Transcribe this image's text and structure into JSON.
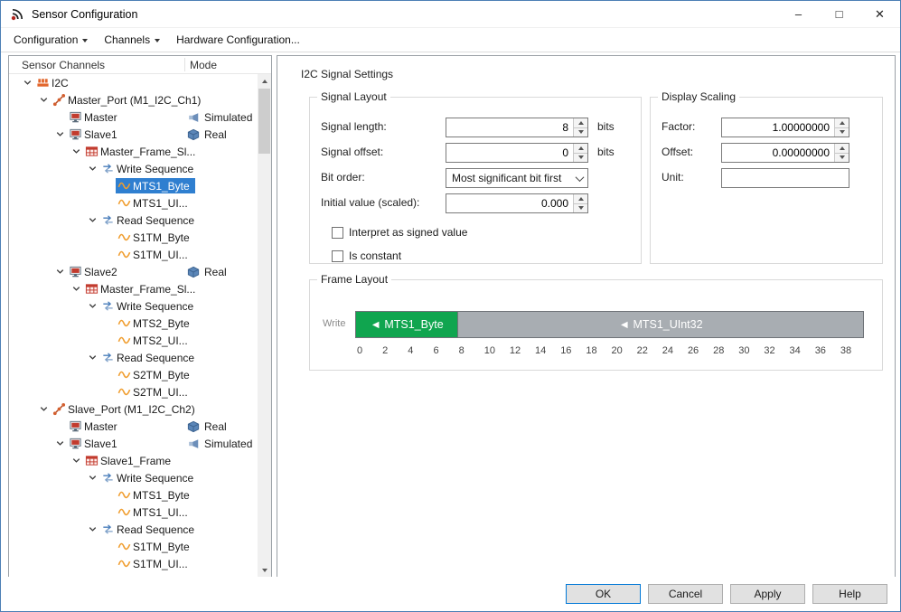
{
  "window": {
    "title": "Sensor Configuration",
    "controls": {
      "minimize": "–",
      "maximize": "□",
      "close": "✕"
    }
  },
  "colors": {
    "selection_blue": "#2f7fd0",
    "segment_green": "#10a54f",
    "segment_gray": "#a8adb2",
    "default_button_border": "#0078d7"
  },
  "menu": {
    "items": [
      {
        "label": "Configuration",
        "has_dropdown": true
      },
      {
        "label": "Channels",
        "has_dropdown": true
      },
      {
        "label": "Hardware Configuration...",
        "has_dropdown": false
      }
    ]
  },
  "tree": {
    "columns": [
      "Sensor Channels",
      "Mode"
    ],
    "items": [
      {
        "label": "I2C",
        "level": 0,
        "expanded": true,
        "icon": "i2c"
      },
      {
        "label": "Master_Port (M1_I2C_Ch1)",
        "level": 1,
        "expanded": true,
        "icon": "port"
      },
      {
        "label": "Master",
        "level": 2,
        "icon": "device",
        "mode": "Simulated"
      },
      {
        "label": "Slave1",
        "level": 2,
        "expanded": true,
        "icon": "device",
        "mode": "Real"
      },
      {
        "label": "Master_Frame_Sl...",
        "level": 3,
        "expanded": true,
        "icon": "frame"
      },
      {
        "label": "Write Sequence",
        "level": 4,
        "expanded": true,
        "icon": "sequence"
      },
      {
        "label": "MTS1_Byte",
        "level": 5,
        "icon": "signal",
        "selected": true
      },
      {
        "label": "MTS1_UI...",
        "level": 5,
        "icon": "signal"
      },
      {
        "label": "Read Sequence",
        "level": 4,
        "expanded": true,
        "icon": "sequence"
      },
      {
        "label": "S1TM_Byte",
        "level": 5,
        "icon": "signal"
      },
      {
        "label": "S1TM_UI...",
        "level": 5,
        "icon": "signal"
      },
      {
        "label": "Slave2",
        "level": 2,
        "expanded": true,
        "icon": "device",
        "mode": "Real"
      },
      {
        "label": "Master_Frame_Sl...",
        "level": 3,
        "expanded": true,
        "icon": "frame"
      },
      {
        "label": "Write Sequence",
        "level": 4,
        "expanded": true,
        "icon": "sequence"
      },
      {
        "label": "MTS2_Byte",
        "level": 5,
        "icon": "signal"
      },
      {
        "label": "MTS2_UI...",
        "level": 5,
        "icon": "signal"
      },
      {
        "label": "Read Sequence",
        "level": 4,
        "expanded": true,
        "icon": "sequence"
      },
      {
        "label": "S2TM_Byte",
        "level": 5,
        "icon": "signal"
      },
      {
        "label": "S2TM_UI...",
        "level": 5,
        "icon": "signal"
      },
      {
        "label": "Slave_Port (M1_I2C_Ch2)",
        "level": 1,
        "expanded": true,
        "icon": "port"
      },
      {
        "label": "Master",
        "level": 2,
        "icon": "device",
        "mode": "Real"
      },
      {
        "label": "Slave1",
        "level": 2,
        "expanded": true,
        "icon": "device",
        "mode": "Simulated"
      },
      {
        "label": "Slave1_Frame",
        "level": 3,
        "expanded": true,
        "icon": "frame"
      },
      {
        "label": "Write Sequence",
        "level": 4,
        "expanded": true,
        "icon": "sequence"
      },
      {
        "label": "MTS1_Byte",
        "level": 5,
        "icon": "signal"
      },
      {
        "label": "MTS1_UI...",
        "level": 5,
        "icon": "signal"
      },
      {
        "label": "Read Sequence",
        "level": 4,
        "expanded": true,
        "icon": "sequence"
      },
      {
        "label": "S1TM_Byte",
        "level": 5,
        "icon": "signal"
      },
      {
        "label": "S1TM_UI...",
        "level": 5,
        "icon": "signal"
      }
    ]
  },
  "settings": {
    "title": "I2C Signal Settings",
    "signal_layout": {
      "title": "Signal Layout",
      "signal_length_label": "Signal length:",
      "signal_length_value": "8",
      "signal_length_unit": "bits",
      "signal_offset_label": "Signal offset:",
      "signal_offset_value": "0",
      "signal_offset_unit": "bits",
      "bit_order_label": "Bit order:",
      "bit_order_value": "Most significant bit first",
      "initial_value_label": "Initial value (scaled):",
      "initial_value_value": "0.000",
      "signed_checkbox_label": "Interpret as signed value",
      "constant_checkbox_label": "Is constant"
    },
    "display_scaling": {
      "title": "Display Scaling",
      "factor_label": "Factor:",
      "factor_value": "1.00000000",
      "offset_label": "Offset:",
      "offset_value": "0.00000000",
      "unit_label": "Unit:",
      "unit_value": ""
    },
    "frame_layout": {
      "title": "Frame Layout",
      "row_label": "Write",
      "total_bits": 40,
      "segments": [
        {
          "label": "◄ MTS1_Byte",
          "start": 0,
          "end": 8,
          "color": "#10a54f"
        },
        {
          "label": "◄ MTS1_UInt32",
          "start": 8,
          "end": 40,
          "color": "#a8adb2"
        }
      ],
      "ruler_ticks": [
        "0",
        "2",
        "4",
        "6",
        "8",
        "10",
        "12",
        "14",
        "16",
        "18",
        "20",
        "22",
        "24",
        "26",
        "28",
        "30",
        "32",
        "34",
        "36",
        "38"
      ]
    }
  },
  "footer": {
    "buttons": [
      "OK",
      "Cancel",
      "Apply",
      "Help"
    ]
  }
}
